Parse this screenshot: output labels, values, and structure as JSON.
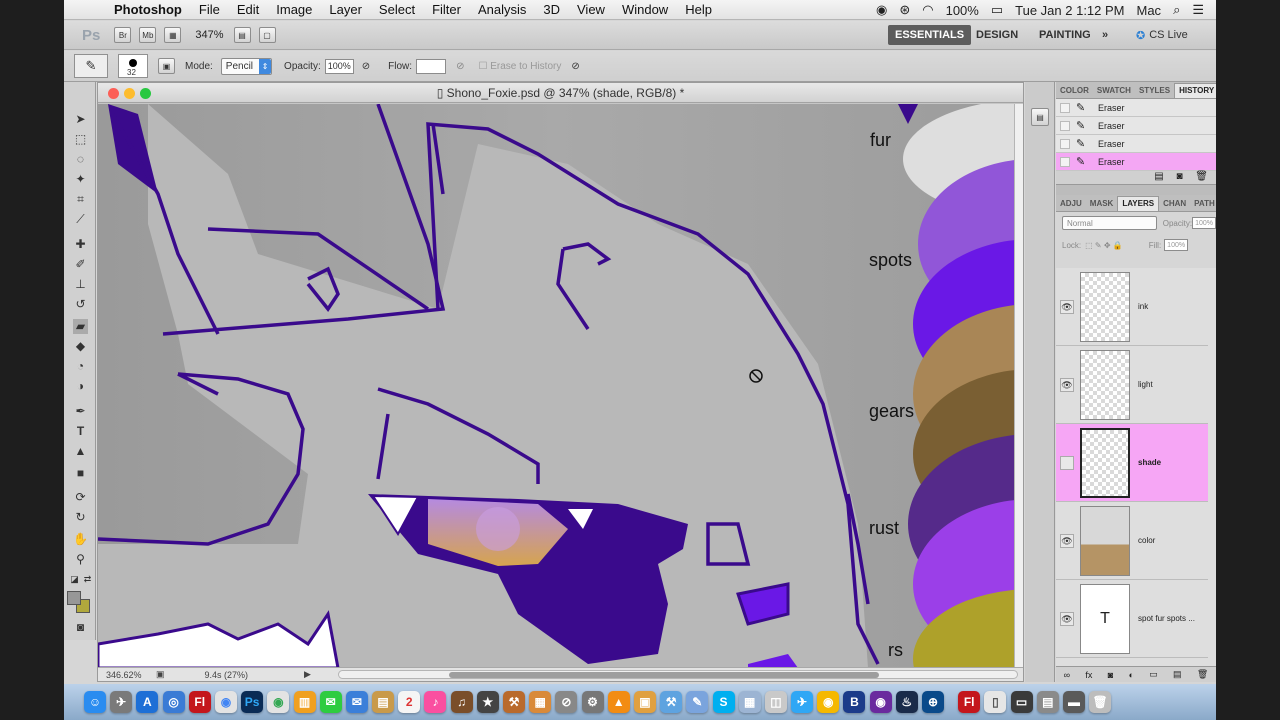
{
  "menubar": {
    "app": "Photoshop",
    "menus": [
      "File",
      "Edit",
      "Image",
      "Layer",
      "Select",
      "Filter",
      "Analysis",
      "3D",
      "View",
      "Window",
      "Help"
    ],
    "battery": "100%",
    "datetime": "Tue Jan 2  1:12 PM",
    "user": "Mac"
  },
  "appbar": {
    "logo": "Ps",
    "br": "Br",
    "mb": "Mb",
    "zoom": "347%",
    "workspaces": [
      "ESSENTIALS",
      "DESIGN",
      "PAINTING"
    ],
    "cslive": "CS Live"
  },
  "options": {
    "brush_size": "32",
    "mode_label": "Mode:",
    "mode_value": "Pencil",
    "opacity_label": "Opacity:",
    "opacity_value": "100%",
    "flow_label": "Flow:",
    "erase_history": "Erase to History"
  },
  "document": {
    "title": "Shono_Foxie.psd @ 347% (shade, RGB/8) *",
    "status_zoom": "346.62%",
    "status_info": "9.4s (27%)",
    "canvas_labels": [
      "fur",
      "spots",
      "gears",
      "rust",
      "rs"
    ]
  },
  "panels": {
    "top_tabs": [
      "COLOR",
      "SWATCH",
      "STYLES",
      "HISTORY"
    ],
    "history": [
      "Eraser",
      "Eraser",
      "Eraser",
      "Eraser"
    ],
    "layer_tabs": [
      "ADJU",
      "MASK",
      "LAYERS",
      "CHAN",
      "PATH"
    ],
    "blend_mode": "Normal",
    "opacity_label": "Opacity:",
    "opacity_value": "100%",
    "lock_label": "Lock:",
    "fill_label": "Fill:",
    "fill_value": "100%",
    "layers": [
      {
        "name": "ink",
        "visible": true
      },
      {
        "name": "light",
        "visible": true
      },
      {
        "name": "shade",
        "visible": false,
        "active": true
      },
      {
        "name": "color",
        "visible": true
      },
      {
        "name": "spot    fur    spots   ...",
        "visible": true,
        "text_layer": true
      }
    ],
    "text_layer_glyph": "T"
  },
  "colors": {
    "accent": "#f4a7f4",
    "ink": "#3a0a8c",
    "fill_gray": "#b8b8b8"
  }
}
